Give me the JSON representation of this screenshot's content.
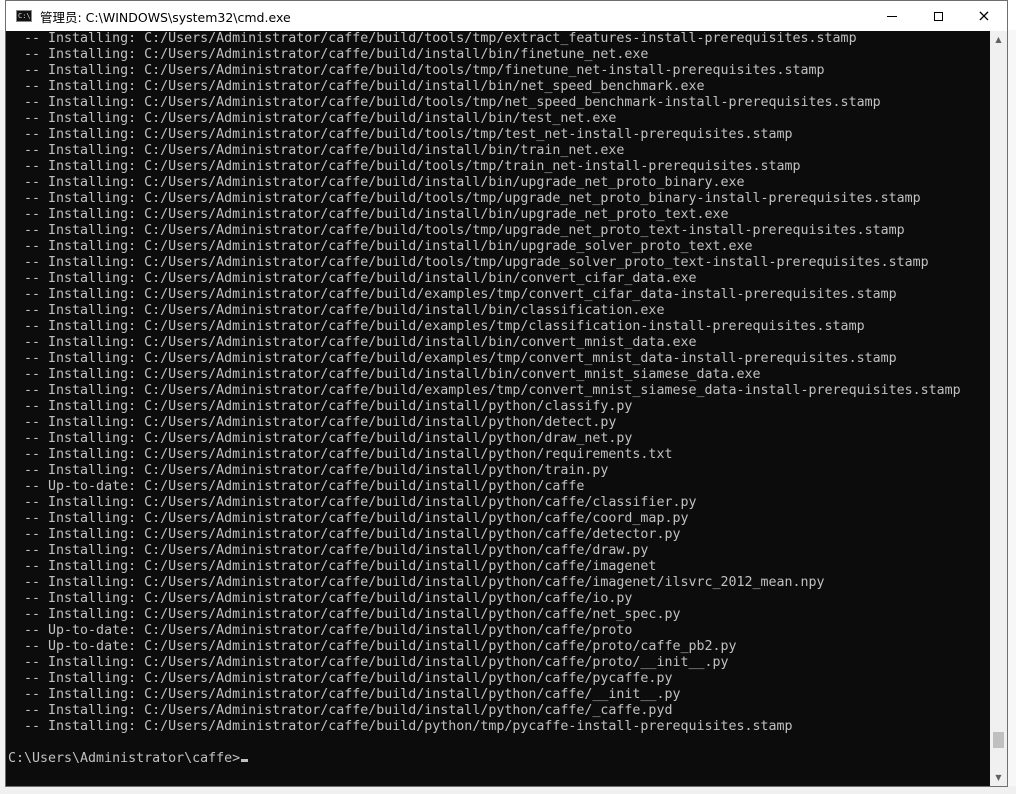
{
  "window": {
    "title": "管理员: C:\\WINDOWS\\system32\\cmd.exe",
    "app_icon_text": "C:\\",
    "controls": {
      "minimize": "minimize",
      "maximize": "maximize",
      "close": "×"
    }
  },
  "console": {
    "lines": [
      "  -- Installing: C:/Users/Administrator/caffe/build/tools/tmp/extract_features-install-prerequisites.stamp",
      "  -- Installing: C:/Users/Administrator/caffe/build/install/bin/finetune_net.exe",
      "  -- Installing: C:/Users/Administrator/caffe/build/tools/tmp/finetune_net-install-prerequisites.stamp",
      "  -- Installing: C:/Users/Administrator/caffe/build/install/bin/net_speed_benchmark.exe",
      "  -- Installing: C:/Users/Administrator/caffe/build/tools/tmp/net_speed_benchmark-install-prerequisites.stamp",
      "  -- Installing: C:/Users/Administrator/caffe/build/install/bin/test_net.exe",
      "  -- Installing: C:/Users/Administrator/caffe/build/tools/tmp/test_net-install-prerequisites.stamp",
      "  -- Installing: C:/Users/Administrator/caffe/build/install/bin/train_net.exe",
      "  -- Installing: C:/Users/Administrator/caffe/build/tools/tmp/train_net-install-prerequisites.stamp",
      "  -- Installing: C:/Users/Administrator/caffe/build/install/bin/upgrade_net_proto_binary.exe",
      "  -- Installing: C:/Users/Administrator/caffe/build/tools/tmp/upgrade_net_proto_binary-install-prerequisites.stamp",
      "  -- Installing: C:/Users/Administrator/caffe/build/install/bin/upgrade_net_proto_text.exe",
      "  -- Installing: C:/Users/Administrator/caffe/build/tools/tmp/upgrade_net_proto_text-install-prerequisites.stamp",
      "  -- Installing: C:/Users/Administrator/caffe/build/install/bin/upgrade_solver_proto_text.exe",
      "  -- Installing: C:/Users/Administrator/caffe/build/tools/tmp/upgrade_solver_proto_text-install-prerequisites.stamp",
      "  -- Installing: C:/Users/Administrator/caffe/build/install/bin/convert_cifar_data.exe",
      "  -- Installing: C:/Users/Administrator/caffe/build/examples/tmp/convert_cifar_data-install-prerequisites.stamp",
      "  -- Installing: C:/Users/Administrator/caffe/build/install/bin/classification.exe",
      "  -- Installing: C:/Users/Administrator/caffe/build/examples/tmp/classification-install-prerequisites.stamp",
      "  -- Installing: C:/Users/Administrator/caffe/build/install/bin/convert_mnist_data.exe",
      "  -- Installing: C:/Users/Administrator/caffe/build/examples/tmp/convert_mnist_data-install-prerequisites.stamp",
      "  -- Installing: C:/Users/Administrator/caffe/build/install/bin/convert_mnist_siamese_data.exe",
      "  -- Installing: C:/Users/Administrator/caffe/build/examples/tmp/convert_mnist_siamese_data-install-prerequisites.stamp",
      "  -- Installing: C:/Users/Administrator/caffe/build/install/python/classify.py",
      "  -- Installing: C:/Users/Administrator/caffe/build/install/python/detect.py",
      "  -- Installing: C:/Users/Administrator/caffe/build/install/python/draw_net.py",
      "  -- Installing: C:/Users/Administrator/caffe/build/install/python/requirements.txt",
      "  -- Installing: C:/Users/Administrator/caffe/build/install/python/train.py",
      "  -- Up-to-date: C:/Users/Administrator/caffe/build/install/python/caffe",
      "  -- Installing: C:/Users/Administrator/caffe/build/install/python/caffe/classifier.py",
      "  -- Installing: C:/Users/Administrator/caffe/build/install/python/caffe/coord_map.py",
      "  -- Installing: C:/Users/Administrator/caffe/build/install/python/caffe/detector.py",
      "  -- Installing: C:/Users/Administrator/caffe/build/install/python/caffe/draw.py",
      "  -- Installing: C:/Users/Administrator/caffe/build/install/python/caffe/imagenet",
      "  -- Installing: C:/Users/Administrator/caffe/build/install/python/caffe/imagenet/ilsvrc_2012_mean.npy",
      "  -- Installing: C:/Users/Administrator/caffe/build/install/python/caffe/io.py",
      "  -- Installing: C:/Users/Administrator/caffe/build/install/python/caffe/net_spec.py",
      "  -- Up-to-date: C:/Users/Administrator/caffe/build/install/python/caffe/proto",
      "  -- Up-to-date: C:/Users/Administrator/caffe/build/install/python/caffe/proto/caffe_pb2.py",
      "  -- Installing: C:/Users/Administrator/caffe/build/install/python/caffe/proto/__init__.py",
      "  -- Installing: C:/Users/Administrator/caffe/build/install/python/caffe/pycaffe.py",
      "  -- Installing: C:/Users/Administrator/caffe/build/install/python/caffe/__init__.py",
      "  -- Installing: C:/Users/Administrator/caffe/build/install/python/caffe/_caffe.pyd",
      "  -- Installing: C:/Users/Administrator/caffe/build/python/tmp/pycaffe-install-prerequisites.stamp"
    ],
    "prompt": "C:\\Users\\Administrator\\caffe>"
  },
  "scrollbar": {
    "up_arrow": "▲",
    "down_arrow": "▼",
    "position_fraction": 0.97
  },
  "colors": {
    "console_bg": "#0c0c0c",
    "console_text": "#c0c0c0",
    "titlebar_bg": "#ffffff"
  }
}
